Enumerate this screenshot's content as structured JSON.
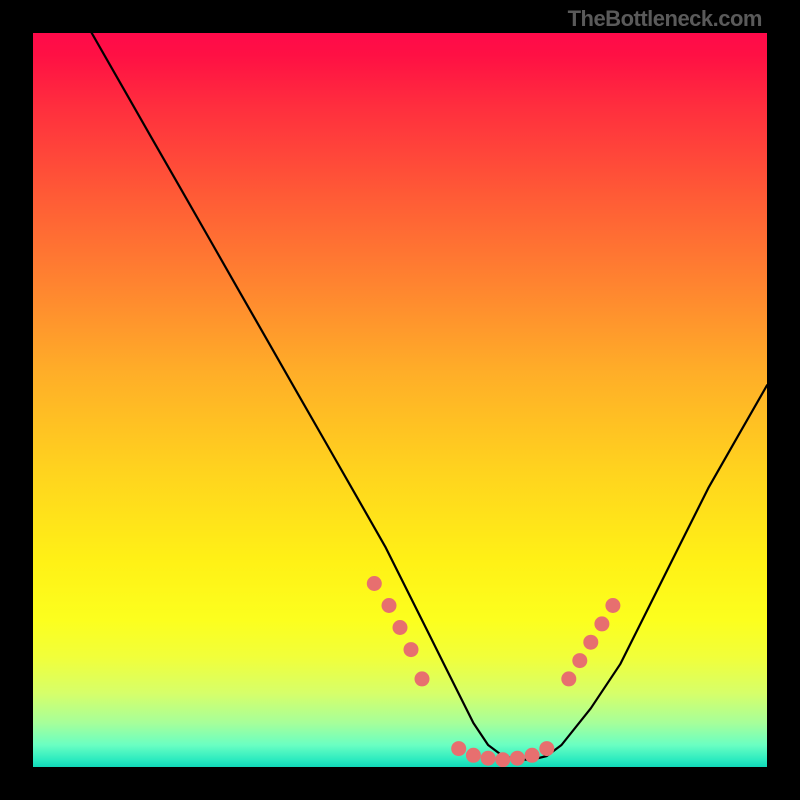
{
  "attribution": "TheBottleneck.com",
  "chart_data": {
    "type": "line",
    "title": "",
    "xlabel": "",
    "ylabel": "",
    "xlim": [
      0,
      100
    ],
    "ylim": [
      0,
      100
    ],
    "series": [
      {
        "name": "curve",
        "x": [
          8,
          12,
          16,
          20,
          24,
          28,
          32,
          36,
          40,
          44,
          48,
          52,
          54,
          56,
          58,
          60,
          62,
          64,
          66,
          68,
          70,
          72,
          76,
          80,
          84,
          88,
          92,
          96,
          100
        ],
        "y": [
          100,
          93,
          86,
          79,
          72,
          65,
          58,
          51,
          44,
          37,
          30,
          22,
          18,
          14,
          10,
          6,
          3,
          1.5,
          1,
          1,
          1.5,
          3,
          8,
          14,
          22,
          30,
          38,
          45,
          52
        ]
      }
    ],
    "markers": {
      "left_cluster": {
        "x": [
          46.5,
          48.5,
          50,
          51.5,
          53
        ],
        "y": [
          25,
          22,
          19,
          16,
          12
        ]
      },
      "bottom_cluster": {
        "x": [
          58,
          60,
          62,
          64,
          66,
          68,
          70
        ],
        "y": [
          2.5,
          1.6,
          1.2,
          1,
          1.2,
          1.6,
          2.5
        ]
      },
      "right_cluster": {
        "x": [
          73,
          74.5,
          76,
          77.5,
          79
        ],
        "y": [
          12,
          14.5,
          17,
          19.5,
          22
        ]
      }
    }
  }
}
